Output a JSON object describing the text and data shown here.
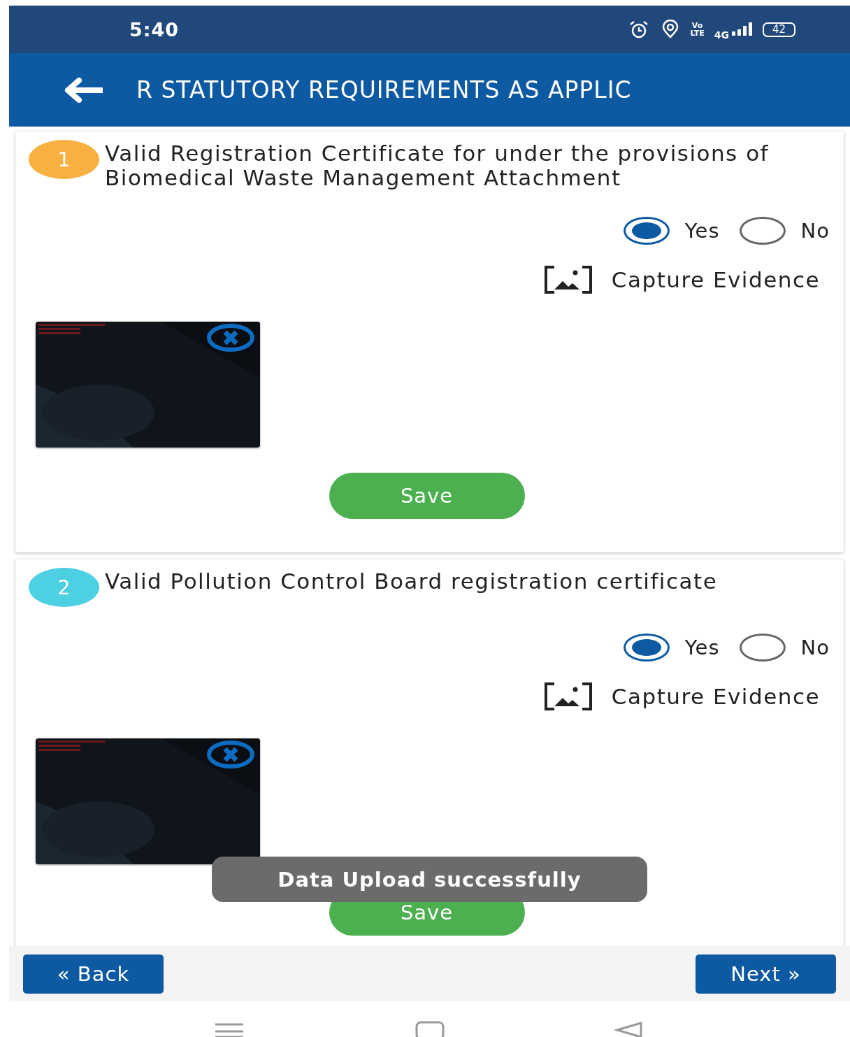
{
  "status_bar": {
    "time": "5:40",
    "volte": [
      "Vo",
      "LTE"
    ],
    "network": "4G",
    "battery": "42"
  },
  "header": {
    "title": "R STATUTORY REQUIREMENTS AS APPLIC"
  },
  "questions": [
    {
      "number": "1",
      "color": "#f9b042",
      "text": "Valid Registration Certificate for under the provisions of Biomedical Waste Management Attachment",
      "options": [
        {
          "label": "Yes",
          "selected": true
        },
        {
          "label": "No",
          "selected": false
        }
      ],
      "capture": "Capture Evidence",
      "save": "Save"
    },
    {
      "number": "2",
      "color": "#4dd0e1",
      "text": "Valid Pollution Control Board registration certificate",
      "options": [
        {
          "label": "Yes",
          "selected": true
        },
        {
          "label": "No",
          "selected": false
        }
      ],
      "capture": "Capture Evidence",
      "save": "Save"
    }
  ],
  "toast": "Data Upload successfully",
  "footer": {
    "back": "« Back",
    "next": "Next »"
  }
}
